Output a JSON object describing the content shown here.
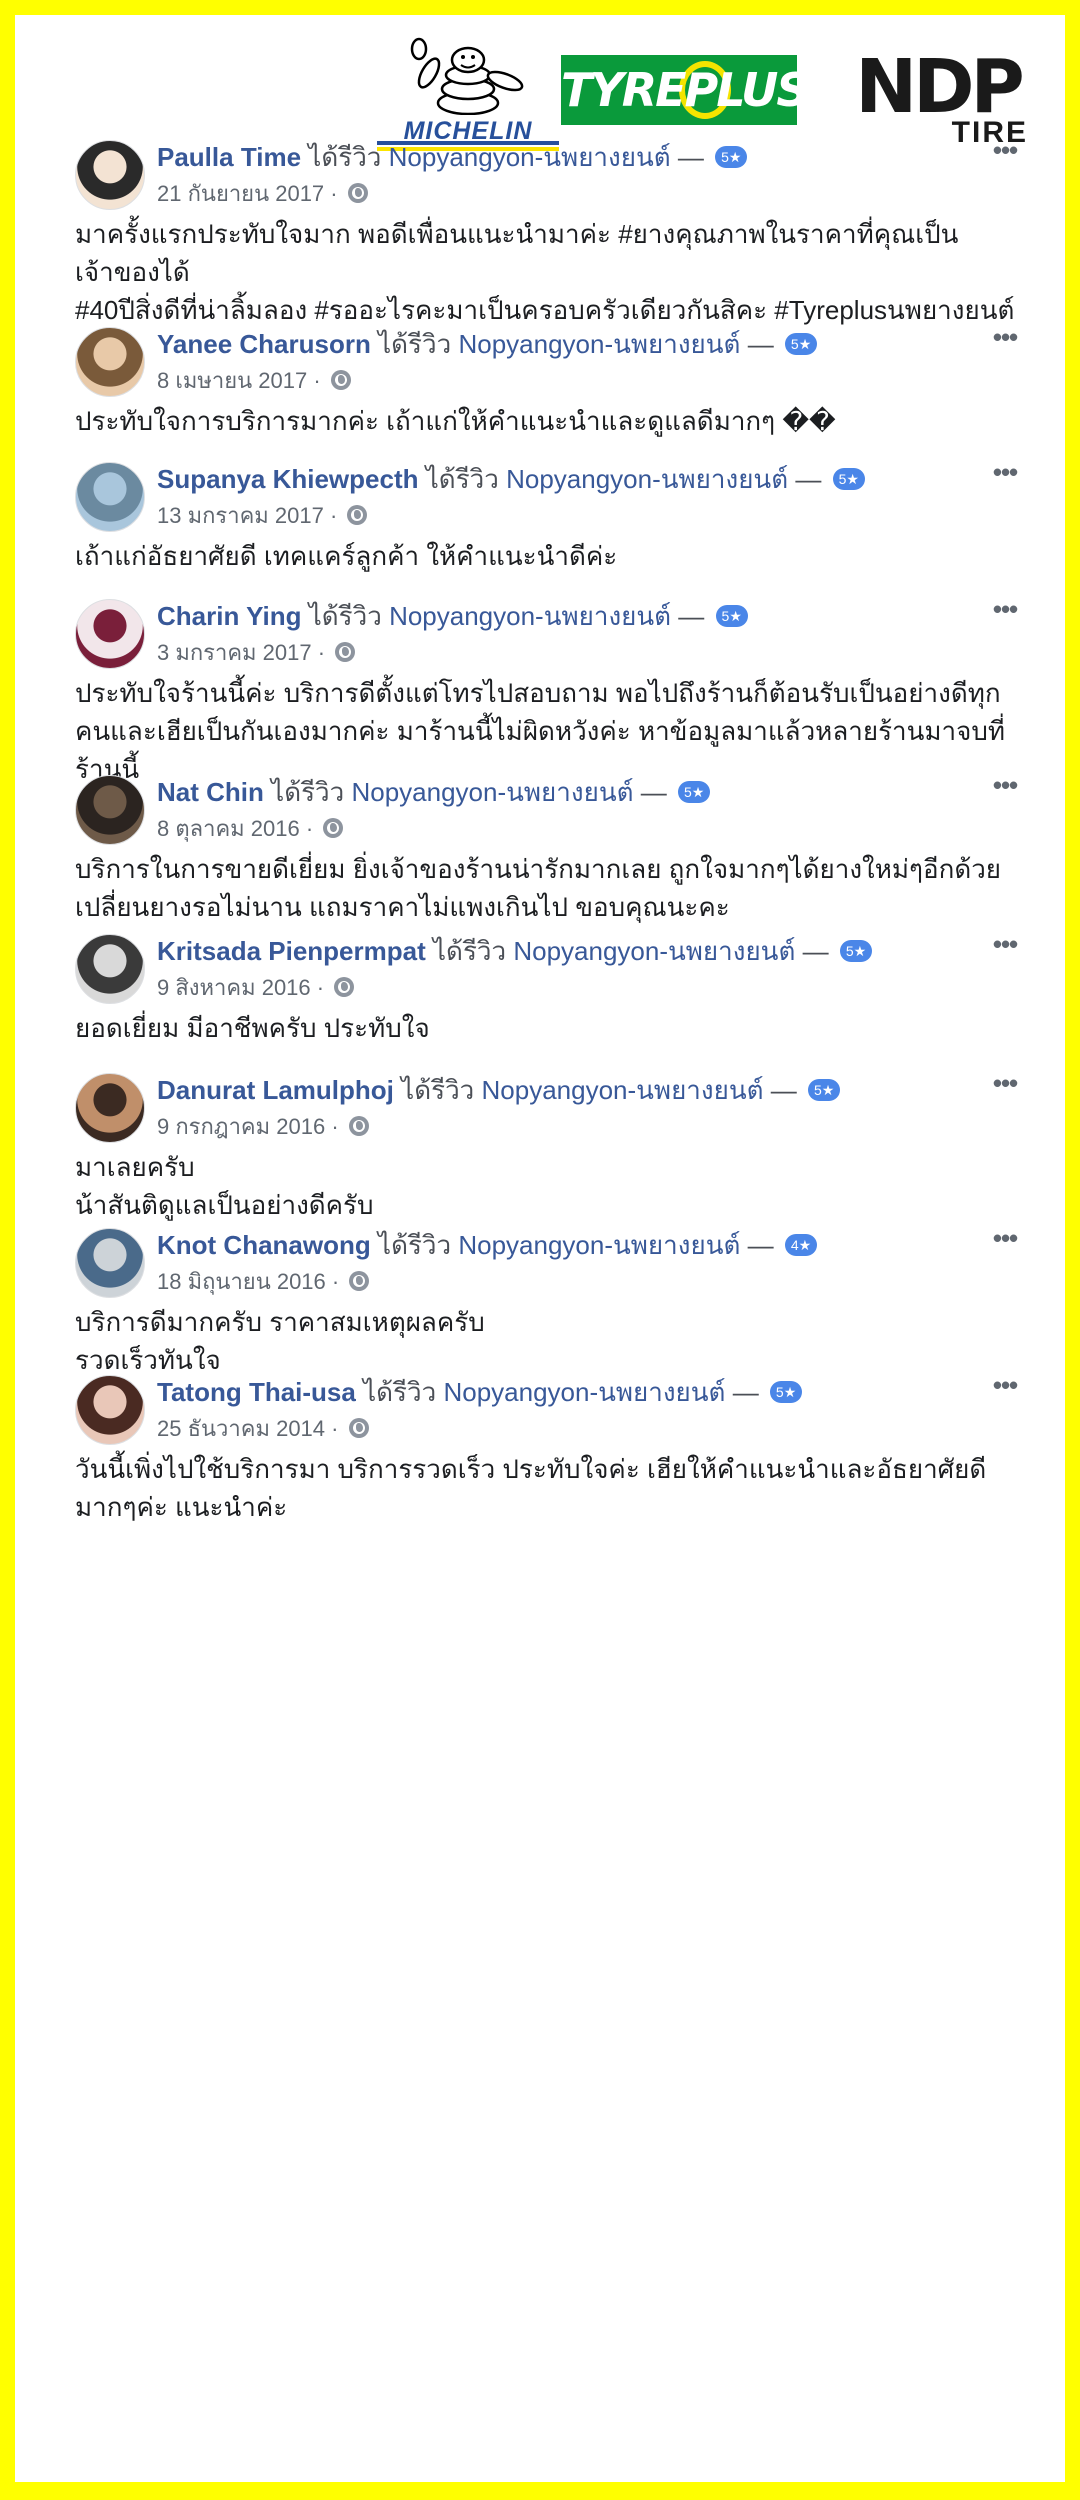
{
  "logos": {
    "michelin": "MICHELIN",
    "tyreplus": "TYREPLUS",
    "ndp_mark": "NDP",
    "ndp_sub": "TIRE"
  },
  "common": {
    "verb": "ได้รีวิว",
    "page_name": "Nopyangyon-นพยางยนต์",
    "dash": "—",
    "dot": "·",
    "more": "•••"
  },
  "reviews": [
    {
      "name": "Paulla Time",
      "rating": "5★",
      "date": "21 กันยายน 2017",
      "text": "มาครั้งแรกประทับใจมาก พอดีเพื่อนแนะนำมาค่ะ #ยางคุณภาพในราคาที่คุณเป็นเจ้าของได้\n#40ปีสิ่งดีที่น่าลิ้มลอง #รออะไรคะมาเป็นครอบครัวเดียวกันสิคะ #Tyreplusนพยางยนต์",
      "avatar_colors": [
        "#f3e3d3",
        "#2a2a2a"
      ]
    },
    {
      "name": "Yanee Charusorn",
      "rating": "5★",
      "date": "8 เมษายน 2017",
      "text": "ประทับใจการบริการมากค่ะ เถ้าแก่ให้คำแนะนำและดูแลดีมากๆ ��",
      "avatar_colors": [
        "#e8c9a8",
        "#7a5a3a"
      ]
    },
    {
      "name": "Supanya Khiewpecth",
      "rating": "5★",
      "date": "13 มกราคม 2017",
      "text": "เถ้าแก่อัธยาศัยดี เทคแคร์ลูกค้า ให้คำแนะนำดีค่ะ",
      "avatar_colors": [
        "#a9c6dc",
        "#6b8aa0"
      ]
    },
    {
      "name": "Charin Ying",
      "rating": "5★",
      "date": "3 มกราคม 2017",
      "text": "ประทับใจร้านนี้ค่ะ บริการดีตั้งแต่โทรไปสอบถาม พอไปถึงร้านก็ต้อนรับเป็นอย่างดีทุกคนและเฮียเป็นกันเองมากค่ะ มาร้านนี้ไม่ผิดหวังค่ะ หาข้อมูลมาแล้วหลายร้านมาจบที่ร้านนี้",
      "avatar_colors": [
        "#7a1f3a",
        "#f2e6ea"
      ]
    },
    {
      "name": "Nat Chin",
      "rating": "5★",
      "date": "8 ตุลาคม 2016",
      "text": "บริการในการขายดีเยี่ยม ยิ่งเจ้าของร้านน่ารักมากเลย ถูกใจมากๆได้ยางใหม่ๆอีกด้วย เปลี่ยนยางรอไม่นาน แถมราคาไม่แพงเกินไป ขอบคุณนะคะ",
      "avatar_colors": [
        "#6e5a48",
        "#2b2420"
      ]
    },
    {
      "name": "Kritsada Pienpermpat",
      "rating": "5★",
      "date": "9 สิงหาคม 2016",
      "text": "ยอดเยี่ยม มีอาชีพครับ ประทับใจ",
      "avatar_colors": [
        "#d9d9d9",
        "#3a3a3a"
      ]
    },
    {
      "name": "Danurat Lamulphoj",
      "rating": "5★",
      "date": "9 กรกฎาคม 2016",
      "text": "มาเลยครับ\nน้าสันติดูแลเป็นอย่างดีครับ",
      "avatar_colors": [
        "#3b2a22",
        "#c08f6a"
      ]
    },
    {
      "name": "Knot Chanawong",
      "rating": "4★",
      "date": "18 มิถุนายน 2016",
      "text": "บริการดีมากครับ ราคาสมเหตุผลครับ\nรวดเร็วทันใจ",
      "avatar_colors": [
        "#cdd3d8",
        "#4a6a8a"
      ]
    },
    {
      "name": "Tatong Thai-usa",
      "rating": "5★",
      "date": "25 ธันวาคม 2014",
      "text": "วันนี้เพิ่งไปใช้บริการมา บริการรวดเร็ว ประทับใจค่ะ เฮียให้คำแนะนำและอัธยาศัยดีมากๆค่ะ แนะนำค่ะ",
      "avatar_colors": [
        "#e9c7b8",
        "#4a2a22"
      ]
    }
  ]
}
